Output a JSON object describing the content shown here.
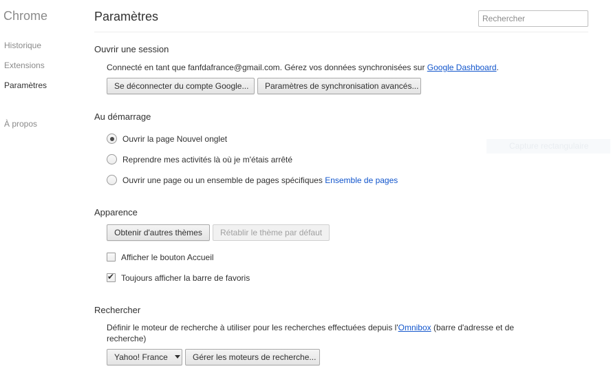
{
  "sidebar": {
    "brand": "Chrome",
    "items": [
      {
        "label": "Historique"
      },
      {
        "label": "Extensions"
      },
      {
        "label": "Paramètres"
      },
      {
        "label": "À propos"
      }
    ]
  },
  "header": {
    "title": "Paramètres",
    "search_placeholder": "Rechercher"
  },
  "signin": {
    "title": "Ouvrir une session",
    "connected_prefix": "Connecté en tant que fanfdafrance@gmail.com. Gérez vos données synchronisées sur ",
    "dashboard_link": "Google Dashboard",
    "connected_suffix": ".",
    "disconnect_button": "Se déconnecter du compte Google...",
    "sync_button": "Paramètres de synchronisation avancés..."
  },
  "startup": {
    "title": "Au démarrage",
    "options": [
      {
        "label": "Ouvrir la page Nouvel onglet",
        "checked": true
      },
      {
        "label": "Reprendre mes activités là où je m'étais arrêté",
        "checked": false
      },
      {
        "label": "Ouvrir une page ou un ensemble de pages spécifiques",
        "checked": false
      }
    ],
    "pages_link": "Ensemble de pages"
  },
  "appearance": {
    "title": "Apparence",
    "themes_button": "Obtenir d'autres thèmes",
    "reset_theme_button": "Rétablir le thème par défaut",
    "home_button_label": "Afficher le bouton Accueil",
    "home_button_checked": false,
    "bookmarks_bar_label": "Toujours afficher la barre de favoris",
    "bookmarks_bar_checked": true
  },
  "search": {
    "title": "Rechercher",
    "description_prefix": "Définir le moteur de recherche à utiliser pour les recherches effectuées depuis l'",
    "omnibox_link": "Omnibox",
    "description_suffix_line1": " (barre d'adresse et de",
    "description_line2": "recherche)",
    "engine_selected": "Yahoo! France",
    "manage_button": "Gérer les moteurs de recherche..."
  },
  "overlay": {
    "ghost_text": "Capture rectangulaire"
  }
}
